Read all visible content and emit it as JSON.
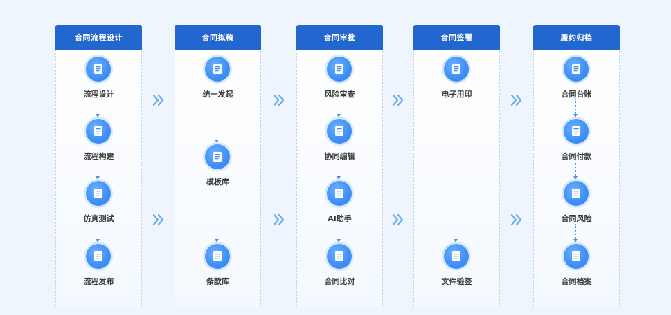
{
  "colors": {
    "header": "#2266cf",
    "node": "#3d8ef5",
    "chevron": "#6aaaf0",
    "line": "#4f93e6"
  },
  "stages": [
    {
      "title": "合同流程设计",
      "nodes": [
        {
          "label": "流程设计",
          "icon": "document-icon"
        },
        {
          "label": "流程构建",
          "icon": "document-icon"
        },
        {
          "label": "仿真测试",
          "icon": "document-icon"
        },
        {
          "label": "流程发布",
          "icon": "document-icon"
        }
      ]
    },
    {
      "title": "合同拟稿",
      "nodes": [
        {
          "label": "统一发起",
          "icon": "document-icon"
        },
        {
          "label": "模板库",
          "icon": "document-icon"
        },
        {
          "label": "条款库",
          "icon": "document-icon"
        }
      ]
    },
    {
      "title": "合同审批",
      "nodes": [
        {
          "label": "风险审查",
          "icon": "document-icon"
        },
        {
          "label": "协同编辑",
          "icon": "document-icon"
        },
        {
          "label": "AI助手",
          "icon": "document-icon"
        },
        {
          "label": "合同比对",
          "icon": "document-icon"
        }
      ]
    },
    {
      "title": "合同签署",
      "nodes": [
        {
          "label": "电子用印",
          "icon": "document-icon"
        },
        {
          "label": "文件验签",
          "icon": "document-icon"
        }
      ]
    },
    {
      "title": "履约归档",
      "nodes": [
        {
          "label": "合同台账",
          "icon": "document-icon"
        },
        {
          "label": "合同付款",
          "icon": "document-icon"
        },
        {
          "label": "合同风险",
          "icon": "document-icon"
        },
        {
          "label": "合同档案",
          "icon": "document-icon"
        }
      ]
    }
  ],
  "separator_icon": "double-chevron-right-icon"
}
